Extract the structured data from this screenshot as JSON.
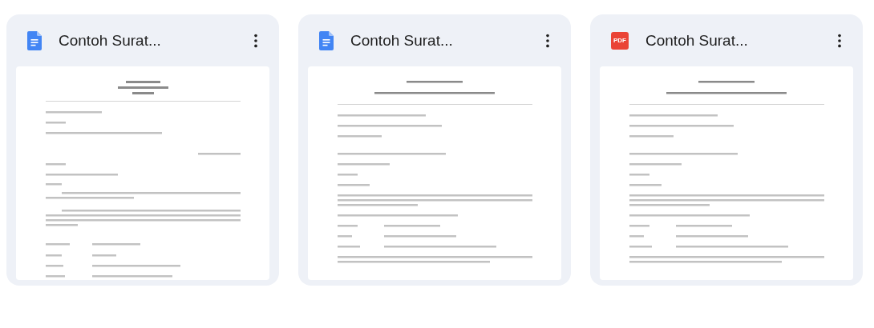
{
  "files": [
    {
      "kind": "docs",
      "title": "Contoh Surat..."
    },
    {
      "kind": "docs",
      "title": "Contoh Surat..."
    },
    {
      "kind": "pdf",
      "badge": "PDF",
      "title": "Contoh Surat..."
    }
  ]
}
